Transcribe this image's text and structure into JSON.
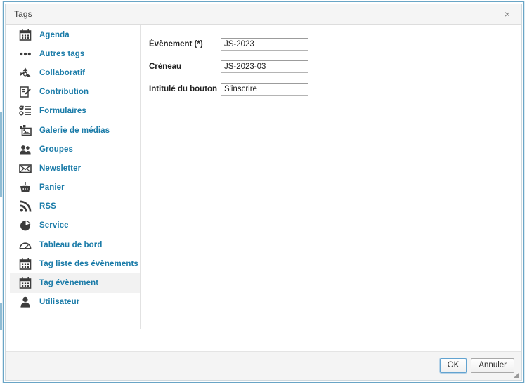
{
  "window": {
    "title": "Tags",
    "close_label": "×",
    "close_icon": "close-icon"
  },
  "sidebar": {
    "items": [
      {
        "label": "Agenda",
        "icon": "calendar-icon",
        "selected": false
      },
      {
        "label": "Autres tags",
        "icon": "ellipsis-icon",
        "selected": false
      },
      {
        "label": "Collaboratif",
        "icon": "recycle-icon",
        "selected": false
      },
      {
        "label": "Contribution",
        "icon": "edit-document-icon",
        "selected": false
      },
      {
        "label": "Formulaires",
        "icon": "checklist-icon",
        "selected": false
      },
      {
        "label": "Galerie de médias",
        "icon": "image-gallery-icon",
        "selected": false
      },
      {
        "label": "Groupes",
        "icon": "users-icon",
        "selected": false
      },
      {
        "label": "Newsletter",
        "icon": "envelope-icon",
        "selected": false
      },
      {
        "label": "Panier",
        "icon": "basket-icon",
        "selected": false
      },
      {
        "label": "RSS",
        "icon": "rss-icon",
        "selected": false
      },
      {
        "label": "Service",
        "icon": "pie-chart-icon",
        "selected": false
      },
      {
        "label": "Tableau de bord",
        "icon": "gauge-icon",
        "selected": false
      },
      {
        "label": "Tag liste des évènements",
        "icon": "calendar-icon",
        "selected": false
      },
      {
        "label": "Tag évènement",
        "icon": "calendar-icon",
        "selected": true
      },
      {
        "label": "Utilisateur",
        "icon": "user-icon",
        "selected": false
      }
    ]
  },
  "form": {
    "fields": [
      {
        "label": "Évènement (*)",
        "value": "JS-2023",
        "placeholder": ""
      },
      {
        "label": "Créneau",
        "value": "JS-2023-03",
        "placeholder": ""
      },
      {
        "label": "Intitulé du bouton",
        "value": "S'inscrire",
        "placeholder": ""
      }
    ]
  },
  "footer": {
    "ok_label": "OK",
    "cancel_label": "Annuler"
  },
  "colors": {
    "frame_border": "#69a5c6",
    "link_text": "#1a7ba8",
    "selected_row": "#f2f2f2",
    "titlebar_bg": "#f5f5f5",
    "footer_bg": "#f4f4f4",
    "primary_button_border": "#62a3d0"
  }
}
